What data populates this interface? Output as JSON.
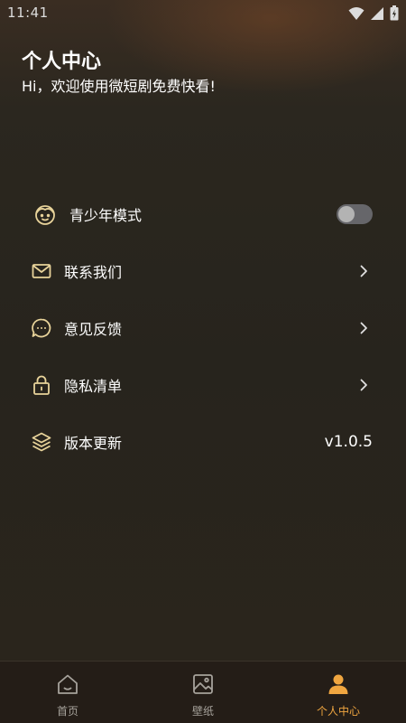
{
  "status_bar": {
    "time": "11:41",
    "icons": [
      "wifi-icon",
      "signal-icon",
      "battery-icon"
    ]
  },
  "header": {
    "title": "个人中心",
    "subtitle": "Hi，欢迎使用微短剧免费快看!"
  },
  "menu": {
    "items": [
      {
        "label": "青少年模式",
        "icon": "child-face-icon",
        "control": "toggle",
        "toggle_on": false
      },
      {
        "label": "联系我们",
        "icon": "mail-icon",
        "control": "chevron"
      },
      {
        "label": "意见反馈",
        "icon": "chat-bubble-icon",
        "control": "chevron"
      },
      {
        "label": "隐私清单",
        "icon": "lock-icon",
        "control": "chevron"
      },
      {
        "label": "版本更新",
        "icon": "layers-icon",
        "control": "version",
        "version": "v1.0.5"
      }
    ]
  },
  "bottom_nav": {
    "tabs": [
      {
        "label": "首页",
        "icon": "home-icon",
        "active": false
      },
      {
        "label": "壁纸",
        "icon": "wallpaper-icon",
        "active": false
      },
      {
        "label": "个人中心",
        "icon": "person-icon",
        "active": true
      }
    ]
  },
  "colors": {
    "accent": "#f0a640",
    "icon_gold": "#e8d39a",
    "inactive": "#a6a29b",
    "nav_background": "#241d17"
  }
}
